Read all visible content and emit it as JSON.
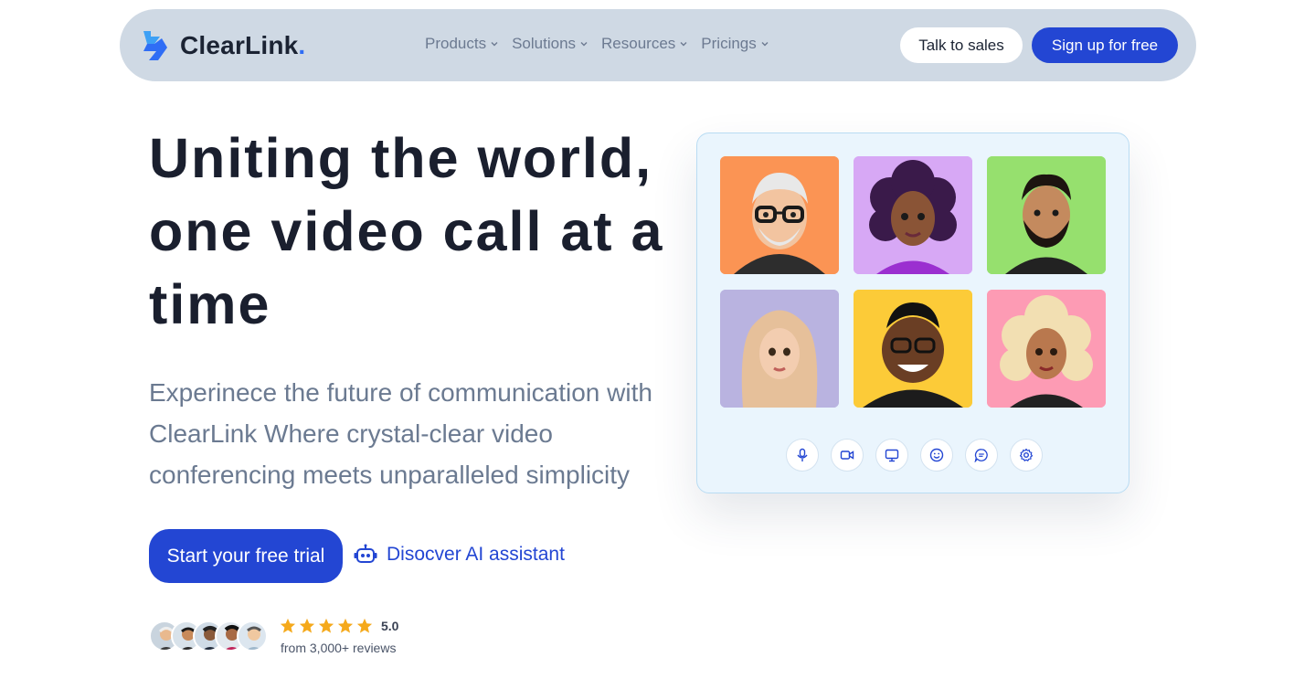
{
  "brand": {
    "name": "ClearLink",
    "dot": ".",
    "accent": "#2f6df5"
  },
  "nav": {
    "items": [
      {
        "label": "Products"
      },
      {
        "label": "Solutions"
      },
      {
        "label": "Resources"
      },
      {
        "label": "Pricings"
      }
    ],
    "talk_label": "Talk to sales",
    "signup_label": "Sign up for free"
  },
  "hero": {
    "title": "Uniting the world, one video call at a time",
    "subtitle": "Experinece the future of communication with ClearLink Where crystal-clear video conferencing meets unparalleled simplicity",
    "cta_label": "Start your free trial",
    "ai_label": "Disocver AI assistant"
  },
  "reviews": {
    "rating": "5.0",
    "stars": 5,
    "text": "from 3,000+ reviews"
  },
  "call": {
    "participants": [
      {
        "bg": "#fb9454",
        "name": "participant-elder-man"
      },
      {
        "bg": "#d7a8f5",
        "name": "participant-curly-woman"
      },
      {
        "bg": "#96e06e",
        "name": "participant-bearded-man"
      },
      {
        "bg": "#b9b3e0",
        "name": "participant-hijab-woman"
      },
      {
        "bg": "#fccb38",
        "name": "participant-smiling-man"
      },
      {
        "bg": "#fd9bb4",
        "name": "participant-blonde-woman"
      }
    ],
    "controls": [
      "microphone-icon",
      "video-camera-icon",
      "screen-share-icon",
      "emoji-icon",
      "chat-icon",
      "settings-icon"
    ]
  },
  "colors": {
    "primary": "#2346d3",
    "nav_bg": "#cfd9e4",
    "card_bg": "#eaf5fd",
    "star": "#f5a91b"
  }
}
